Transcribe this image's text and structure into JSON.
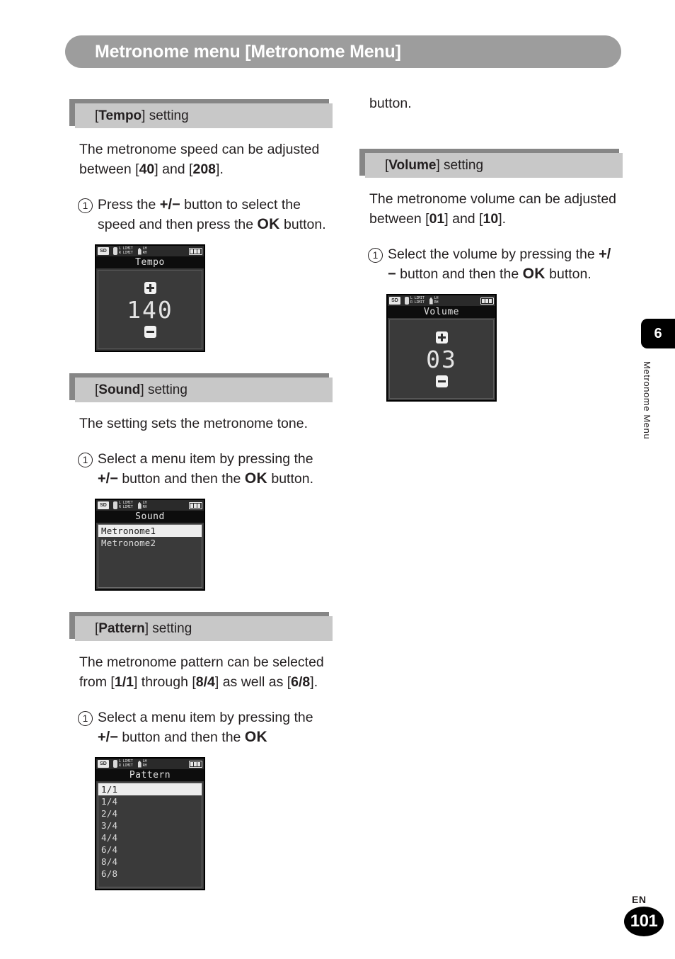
{
  "page": {
    "banner_title": "Metronome menu [Metronome Menu]",
    "chapter_number": "6",
    "chapter_label": "Metronome Menu",
    "language_code": "EN",
    "page_number": "101"
  },
  "left_column": {
    "sections": [
      {
        "title_bracket_open": "[",
        "title_bold": "Tempo",
        "title_rest": "] setting",
        "body_prefix": "The metronome speed can be adjusted between [",
        "body_bold_1": "40",
        "body_mid": "] and [",
        "body_bold_2": "208",
        "body_suffix": "].",
        "step_number": "1",
        "step_line_1a": "Press the ",
        "step_pm": "+/−",
        "step_line_1b": " button to select",
        "step_line_2a": "the speed and then press the ",
        "step_ok": "OK",
        "step_line_3": "button.",
        "screen": {
          "type": "value",
          "title": "Tempo",
          "value": "140",
          "plus_icon": "plus-icon",
          "minus_icon": "minus-icon",
          "status": {
            "sd": "SD",
            "limit_top": "L LIMIT",
            "limit_bottom": "R LIMIT",
            "ch_top": "LH",
            "ch_bottom": "RH",
            "battery_icon": "battery-icon"
          }
        }
      },
      {
        "title_bracket_open": "[",
        "title_bold": "Sound",
        "title_rest": "] setting",
        "body_text": "The setting sets the metronome tone.",
        "step_number": "1",
        "step_line_1a": "Select a menu item by pressing",
        "step_line_2a": "the ",
        "step_pm": "+/−",
        "step_line_2b": " button and then the ",
        "step_ok": "OK",
        "step_line_3": "button.",
        "screen": {
          "type": "list",
          "title": "Sound",
          "items": [
            "Metronome1",
            "Metronome2"
          ],
          "selected_index": 0,
          "status": {
            "sd": "SD",
            "limit_top": "L LIMIT",
            "limit_bottom": "R LIMIT",
            "ch_top": "LH",
            "ch_bottom": "RH",
            "battery_icon": "battery-icon"
          }
        }
      },
      {
        "title_bracket_open": "[",
        "title_bold": "Pattern",
        "title_rest": "] setting",
        "body_prefix": "The metronome pattern can be selected from [",
        "body_bold_1": "1/1",
        "body_mid": "] through [",
        "body_bold_2": "8/4",
        "body_mid_2": "] as well as [",
        "body_bold_3": "6/8",
        "body_suffix": "].",
        "step_number": "1",
        "step_line_1a": "Select a menu item by pressing",
        "step_line_2a": "the ",
        "step_pm": "+/−",
        "step_line_2b": " button and then the ",
        "step_ok": "OK",
        "screen": {
          "type": "list",
          "title": "Pattern",
          "items": [
            "1/1",
            "1/4",
            "2/4",
            "3/4",
            "4/4",
            "6/4",
            "8/4",
            "6/8"
          ],
          "selected_index": 0,
          "status": {
            "sd": "SD",
            "limit_top": "L LIMIT",
            "limit_bottom": "R LIMIT",
            "ch_top": "LH",
            "ch_bottom": "RH",
            "battery_icon": "battery-icon"
          }
        }
      }
    ]
  },
  "right_column": {
    "carryover_text": "button.",
    "sections": [
      {
        "title_bracket_open": "[",
        "title_bold": "Volume",
        "title_rest": "] setting",
        "body_prefix": "The metronome volume can be adjusted between [",
        "body_bold_1": "01",
        "body_mid": "] and [",
        "body_bold_2": "10",
        "body_suffix": "].",
        "step_number": "1",
        "step_line_1a": "Select the volume by pressing",
        "step_line_2a": "the ",
        "step_pm": "+/−",
        "step_line_2b": " button and then the ",
        "step_ok": "OK",
        "step_line_3": "button.",
        "screen": {
          "type": "value",
          "title": "Volume",
          "value": "03",
          "plus_icon": "plus-icon",
          "minus_icon": "minus-icon",
          "status": {
            "sd": "SD",
            "limit_top": "L LIMIT",
            "limit_bottom": "R LIMIT",
            "ch_top": "LH",
            "ch_bottom": "RH",
            "battery_icon": "battery-icon"
          }
        }
      }
    ]
  }
}
